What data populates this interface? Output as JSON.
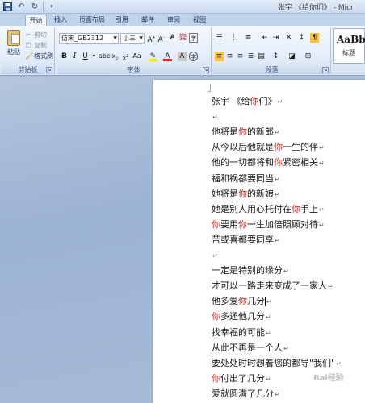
{
  "title_bar": {
    "text": "张宇 《给你们》 - Micr"
  },
  "tabs": [
    "开始",
    "插入",
    "页面布局",
    "引用",
    "邮件",
    "审阅",
    "视图"
  ],
  "clipboard": {
    "paste_label": "粘贴",
    "cut_label": "剪切",
    "copy_label": "复制",
    "format_painter_label": "格式刷",
    "group_label": "剪贴板"
  },
  "font": {
    "font_name": "仿宋_GB2312",
    "font_size": "小三",
    "group_label": "字体"
  },
  "paragraph": {
    "group_label": "段落"
  },
  "styles": {
    "sample": "AaBbC",
    "name": "标题"
  },
  "document": {
    "lines": [
      [
        {
          "t": "张宇 《给"
        },
        {
          "t": "你",
          "h": true
        },
        {
          "t": "们》"
        }
      ],
      [],
      [
        {
          "t": "他将是"
        },
        {
          "t": "你",
          "h": true
        },
        {
          "t": "的新郎"
        }
      ],
      [
        {
          "t": "从今以后他就是"
        },
        {
          "t": "你",
          "h": true
        },
        {
          "t": "一生的伴"
        }
      ],
      [
        {
          "t": "他的一切都将和"
        },
        {
          "t": "你",
          "h": true
        },
        {
          "t": "紧密相关"
        }
      ],
      [
        {
          "t": "福和祸都要同当"
        }
      ],
      [
        {
          "t": "她将是"
        },
        {
          "t": "你",
          "h": true
        },
        {
          "t": "的新娘"
        }
      ],
      [
        {
          "t": "她是别人用心托付在"
        },
        {
          "t": "你",
          "h": true
        },
        {
          "t": "手上"
        }
      ],
      [
        {
          "t": "你",
          "h": true
        },
        {
          "t": "要用"
        },
        {
          "t": "你",
          "h": true
        },
        {
          "t": "一生加倍照顾对待"
        }
      ],
      [
        {
          "t": "苦或喜都要同享"
        }
      ],
      [],
      [
        {
          "t": "一定是特别的缘分"
        }
      ],
      [
        {
          "t": "才可以一路走来变成了一家人"
        }
      ],
      [
        {
          "t": "他多爱"
        },
        {
          "t": "你",
          "h": true
        },
        {
          "t": "几分"
        }
      ],
      [
        {
          "t": "你",
          "h": true
        },
        {
          "t": "多还他几分"
        }
      ],
      [
        {
          "t": "找幸福的可能"
        }
      ],
      [
        {
          "t": "从此不再是一个人"
        }
      ],
      [
        {
          "t": "要处处时时想着您的都导\"我们\""
        }
      ],
      [
        {
          "t": "你",
          "h": true
        },
        {
          "t": "付出了几分"
        }
      ],
      [
        {
          "t": "爱就圆满了几分"
        }
      ]
    ]
  },
  "watermark": {
    "text": "Bai经验"
  }
}
